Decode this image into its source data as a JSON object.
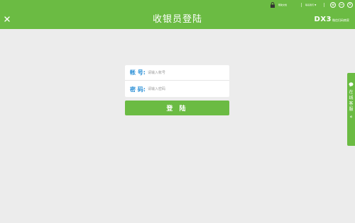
{
  "colors": {
    "accent": "#6bbb43",
    "background": "#ececec",
    "label": "#2a8fd6"
  },
  "topbar": {
    "help_text": "帮助文档",
    "contact_text": "联系我们 ▼",
    "icons": [
      "lock-icon",
      "add-icon",
      "minimize-icon",
      "close-icon"
    ]
  },
  "header": {
    "title": "收银员登陆",
    "brand_mark": "DX3",
    "brand_sub": "微信扫码商家"
  },
  "login": {
    "account_label": "帐 号:",
    "account_placeholder": "请输入帐号",
    "password_label": "密 码:",
    "password_placeholder": "请输入密码",
    "submit_label": "登 陆"
  },
  "side_tab": {
    "lines": [
      "在",
      "线",
      "客",
      "服"
    ],
    "chevron": "«"
  }
}
